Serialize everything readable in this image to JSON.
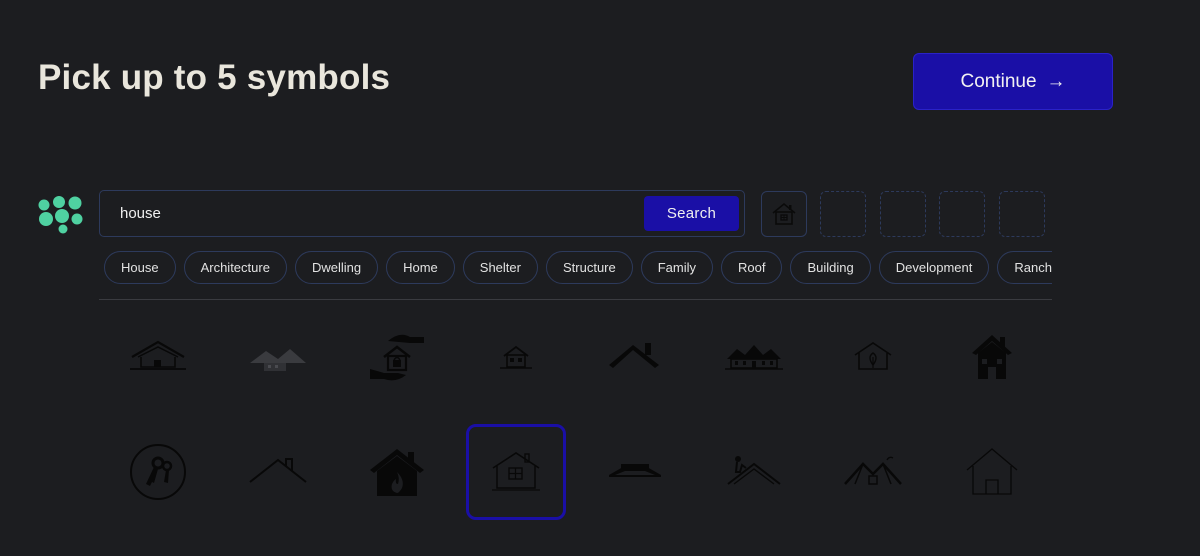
{
  "header": {
    "title": "Pick up to 5 symbols",
    "continue_label": "Continue",
    "continue_arrow": "→"
  },
  "search": {
    "value": "house",
    "button_label": "Search"
  },
  "tags": [
    "House",
    "Architecture",
    "Dwelling",
    "Home",
    "Shelter",
    "Structure",
    "Family",
    "Roof",
    "Building",
    "Development",
    "Ranch"
  ],
  "selected_slots": {
    "filled": [
      "house-window-icon"
    ],
    "empty_count": 4
  },
  "results": {
    "row1": [
      "house-roof-outline-icon",
      "faded-roofs-icon",
      "hands-house-lock-icon",
      "small-house-icon",
      "roof-chimney-icon",
      "row-houses-icon",
      "house-leaf-icon",
      "house-solid-icon"
    ],
    "row2": [
      "key-circle-icon",
      "roof-outline-icon",
      "house-flame-icon",
      "house-window-icon",
      "flat-roof-icon",
      "roof-worker-icon",
      "roof-peaks-icon",
      "house-thin-outline-icon"
    ],
    "selected": "house-window-icon"
  },
  "colors": {
    "background": "#1c1d20",
    "accent": "#1a0fa6",
    "logo": "#4fd1a1",
    "border": "#2d3a5c"
  }
}
